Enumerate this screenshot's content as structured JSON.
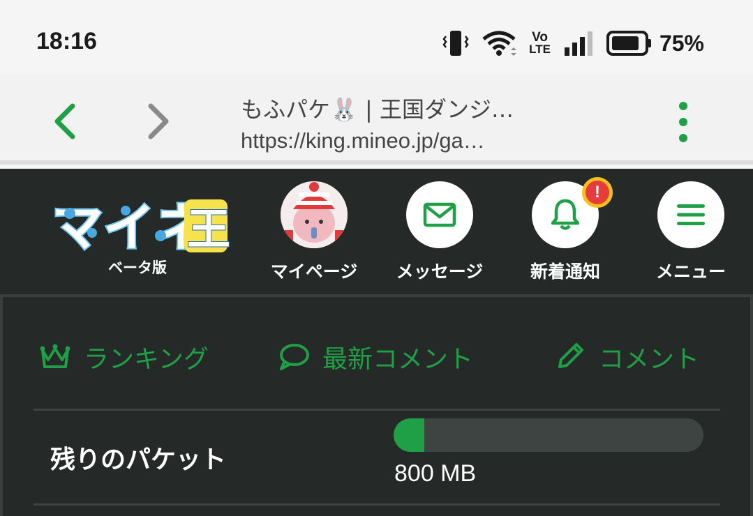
{
  "status_bar": {
    "time": "18:16",
    "network_label_top": "Vo",
    "network_label_bottom": "LTE",
    "battery_percent": "75%",
    "icons": [
      "vibrate-icon",
      "wifi-icon",
      "volte-icon",
      "signal-icon",
      "battery-icon"
    ]
  },
  "browser": {
    "tab_title": "もふパケ🐰 | 王国ダンジ…",
    "url": "https://king.mineo.jp/ga…",
    "accent_color": "#1fa047"
  },
  "header": {
    "logo_text": "マイネ王",
    "logo_sub": "ベータ版",
    "mypage_label": "マイページ",
    "messages_label": "メッセージ",
    "notifications_label": "新着通知",
    "notifications_badge": "!",
    "menu_label": "メニュー"
  },
  "quick_links": {
    "ranking": "ランキング",
    "latest_comments": "最新コメント",
    "comment": "コメント"
  },
  "packet": {
    "label": "残りのパケット",
    "amount": "800 MB",
    "fill_fraction": 0.1
  },
  "colors": {
    "header_bg": "#252a28",
    "accent": "#1fa047",
    "badge_red": "#e83b3b",
    "badge_yellow": "#f2c21b"
  }
}
